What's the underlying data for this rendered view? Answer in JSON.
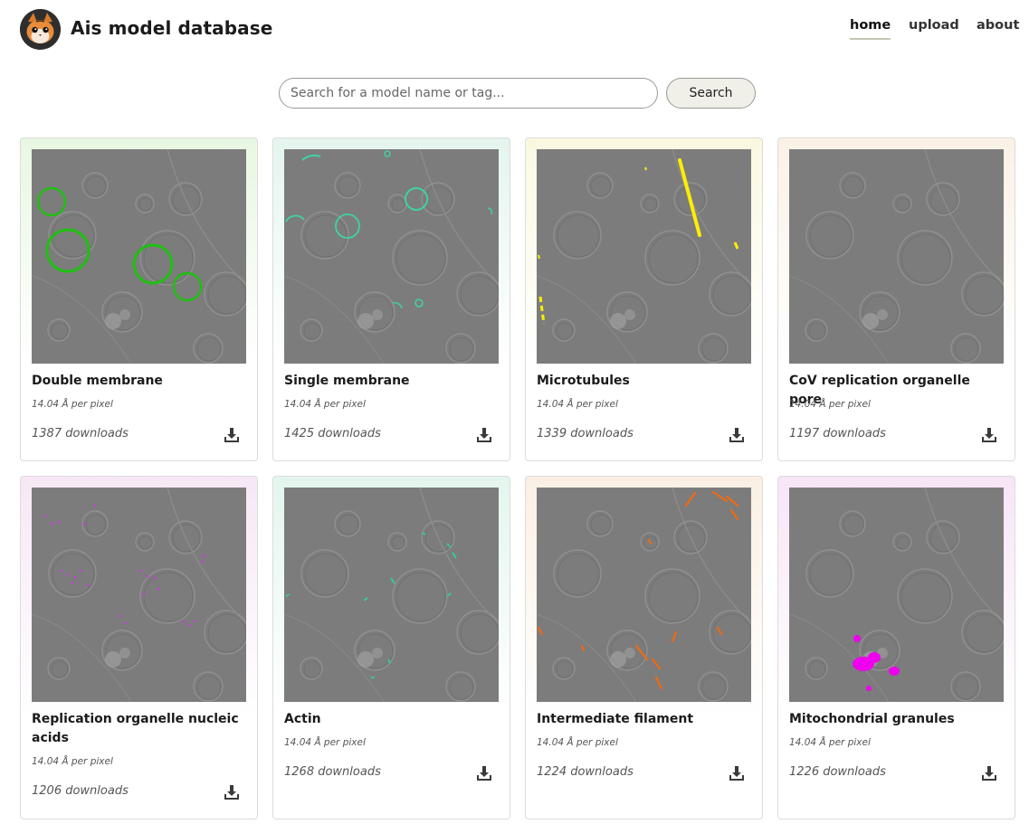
{
  "header": {
    "title": "Ais model database",
    "logo_icon": "cat-logo-icon",
    "nav": [
      {
        "label": "home",
        "active": true
      },
      {
        "label": "upload",
        "active": false
      },
      {
        "label": "about",
        "active": false
      }
    ]
  },
  "search": {
    "placeholder": "Search for a model name or tag...",
    "value": "",
    "button_label": "Search"
  },
  "models": [
    {
      "name": "Double membrane",
      "resolution": "14.04 Å per pixel",
      "downloads": "1387 downloads",
      "accent": "#e8f7e2",
      "overlay": "#1fbf12",
      "shape": "rings"
    },
    {
      "name": "Single membrane",
      "resolution": "14.04 Å per pixel",
      "downloads": "1425 downloads",
      "accent": "#e4f5ee",
      "overlay": "#3fd2a5",
      "shape": "arcs"
    },
    {
      "name": "Microtubules",
      "resolution": "14.04 Å per pixel",
      "downloads": "1339 downloads",
      "accent": "#fbf8e1",
      "overlay": "#ffee00",
      "shape": "lines"
    },
    {
      "name": "CoV replication organelle pore",
      "resolution": "14.04 Å per pixel",
      "downloads": "1197 downloads",
      "accent": "#fbf1e6",
      "overlay": "#ff9a3c",
      "shape": "none"
    },
    {
      "name": "Replication organelle nucleic acids",
      "resolution": "14.04 Å per pixel",
      "downloads": "1206 downloads",
      "accent": "#f7e7f5",
      "overlay": "#c33fd8",
      "shape": "dots"
    },
    {
      "name": "Actin",
      "resolution": "14.04 Å per pixel",
      "downloads": "1268 downloads",
      "accent": "#e3f6ee",
      "overlay": "#2fd19a",
      "shape": "dashes"
    },
    {
      "name": "Intermediate filament",
      "resolution": "14.04 Å per pixel",
      "downloads": "1224 downloads",
      "accent": "#fbefe4",
      "overlay": "#f06a10",
      "shape": "streaks"
    },
    {
      "name": "Mitochondrial granules",
      "resolution": "14.04 Å per pixel",
      "downloads": "1226 downloads",
      "accent": "#f7e5f6",
      "overlay": "#ee00ee",
      "shape": "blobs"
    }
  ],
  "icons": {
    "download": "download-icon"
  }
}
